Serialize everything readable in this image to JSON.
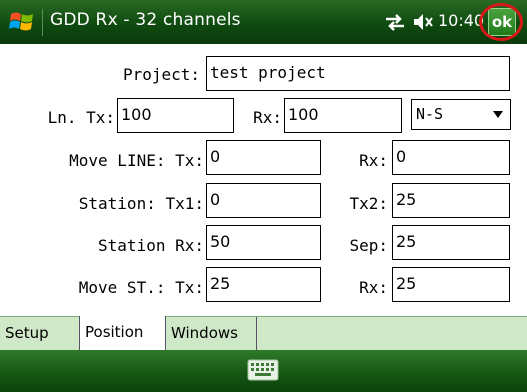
{
  "window": {
    "title": "GDD Rx - 32 channels",
    "time": "10:40",
    "ok_label": "ok",
    "icons": [
      "windows-start-icon",
      "connectivity-icon",
      "volume-icon",
      "keyboard-icon"
    ],
    "accent_color": "#0f4a10",
    "highlight_color": "#d81818"
  },
  "form": {
    "project": {
      "label": "Project:",
      "value": "test project"
    },
    "line": {
      "ln_label": "Ln. Tx:",
      "ln_tx": "100",
      "rx_label": "Rx:",
      "rx": "100",
      "direction": "N-S"
    },
    "move_line": {
      "label": "Move LINE: Tx:",
      "tx": "0",
      "rx_label": "Rx:",
      "rx": "0"
    },
    "station": {
      "label": "Station: Tx1:",
      "tx1": "0",
      "tx2_label": "Tx2:",
      "tx2": "25"
    },
    "station_rx": {
      "label": "Station Rx:",
      "value": "50",
      "sep_label": "Sep:",
      "sep": "25"
    },
    "move_st": {
      "label": "Move ST.: Tx:",
      "tx": "25",
      "rx_label": "Rx:",
      "rx": "25"
    }
  },
  "tabs": [
    "Setup",
    "Position",
    "Windows"
  ],
  "active_tab": "Position"
}
